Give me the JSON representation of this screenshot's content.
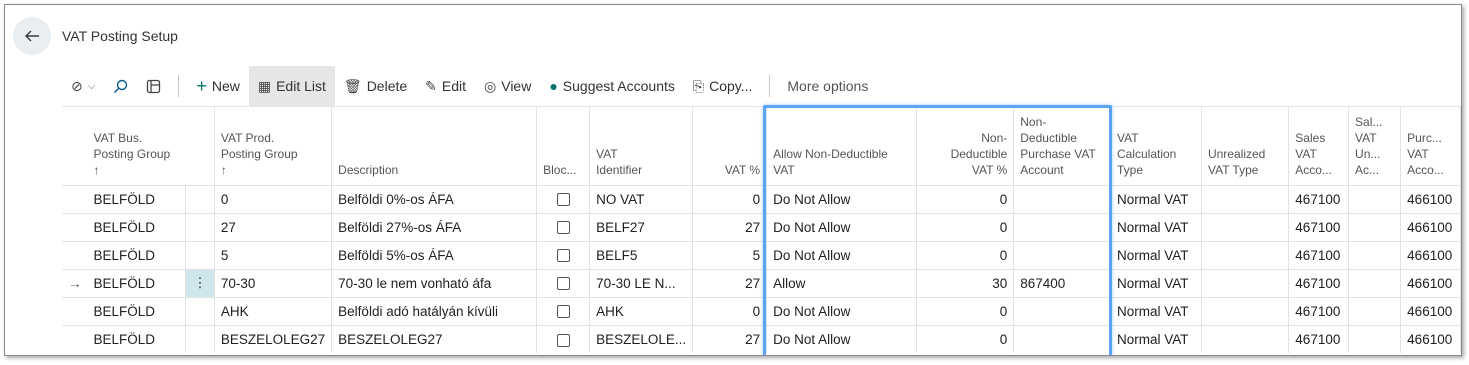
{
  "page": {
    "title": "VAT Posting Setup"
  },
  "toolbar": {
    "new_label": "New",
    "edit_list_label": "Edit List",
    "delete_label": "Delete",
    "edit_label": "Edit",
    "view_label": "View",
    "suggest_label": "Suggest Accounts",
    "copy_label": "Copy...",
    "more_label": "More options"
  },
  "columns": {
    "bus_group": [
      "VAT Bus.",
      "Posting Group",
      "↑"
    ],
    "prod_group": [
      "VAT Prod.",
      "Posting Group",
      "↑"
    ],
    "description": "Description",
    "blocked": "Bloc...",
    "identifier": [
      "VAT",
      "Identifier"
    ],
    "vat_pct": "VAT %",
    "allow_nd": [
      "Allow Non-Deductible",
      "VAT"
    ],
    "nd_pct": [
      "Non-",
      "Deductible",
      "VAT %"
    ],
    "nd_account": [
      "Non-",
      "Deductible",
      "Purchase VAT",
      "Account"
    ],
    "calc_type": [
      "VAT",
      "Calculation",
      "Type"
    ],
    "unrealized": [
      "Unrealized",
      "VAT Type"
    ],
    "sales_acc": [
      "Sales",
      "VAT",
      "Acco..."
    ],
    "sales_un": [
      "Sal...",
      "VAT",
      "Un...",
      "Ac..."
    ],
    "purch_acc": [
      "Purc...",
      "VAT",
      "Acco..."
    ]
  },
  "rows": [
    {
      "arrow": "",
      "bus": "BELFÖLD",
      "prod": "0",
      "desc": "Belföldi 0%-os ÁFA",
      "ident": "NO VAT",
      "pct": "0",
      "allow": "Do Not Allow",
      "ndpct": "0",
      "ndacc": "",
      "calc": "Normal VAT",
      "unreal": "",
      "sales": "467100",
      "salesun": "",
      "purch": "466100"
    },
    {
      "arrow": "",
      "bus": "BELFÖLD",
      "prod": "27",
      "desc": "Belföldi 27%-os ÁFA",
      "ident": "BELF27",
      "pct": "27",
      "allow": "Do Not Allow",
      "ndpct": "0",
      "ndacc": "",
      "calc": "Normal VAT",
      "unreal": "",
      "sales": "467100",
      "salesun": "",
      "purch": "466100"
    },
    {
      "arrow": "",
      "bus": "BELFÖLD",
      "prod": "5",
      "desc": "Belföldi 5%-os ÁFA",
      "ident": "BELF5",
      "pct": "5",
      "allow": "Do Not Allow",
      "ndpct": "0",
      "ndacc": "",
      "calc": "Normal VAT",
      "unreal": "",
      "sales": "467100",
      "salesun": "",
      "purch": "466100"
    },
    {
      "arrow": "→",
      "bus": "BELFÖLD",
      "prod": "70-30",
      "desc": "70-30 le nem vonható áfa",
      "ident": "70-30 LE N...",
      "pct": "27",
      "allow": "Allow",
      "ndpct": "30",
      "ndacc": "867400",
      "calc": "Normal VAT",
      "unreal": "",
      "sales": "467100",
      "salesun": "",
      "purch": "466100"
    },
    {
      "arrow": "",
      "bus": "BELFÖLD",
      "prod": "AHK",
      "desc": "Belföldi adó hatályán kívüli",
      "ident": "AHK",
      "pct": "0",
      "allow": "Do Not Allow",
      "ndpct": "0",
      "ndacc": "",
      "calc": "Normal VAT",
      "unreal": "",
      "sales": "467100",
      "salesun": "",
      "purch": "466100"
    },
    {
      "arrow": "",
      "bus": "BELFÖLD",
      "prod": "BESZELOLEG27",
      "desc": "BESZELOLEG27",
      "ident": "BESZELOLE...",
      "pct": "27",
      "allow": "Do Not Allow",
      "ndpct": "0",
      "ndacc": "",
      "calc": "Normal VAT",
      "unreal": "",
      "sales": "467100",
      "salesun": "",
      "purch": "466100"
    }
  ],
  "row_actions_icon": "⋮",
  "colors": {
    "accent": "#00736b",
    "highlight": "#5ba4f5",
    "selected_cell": "#cfe7ec"
  }
}
